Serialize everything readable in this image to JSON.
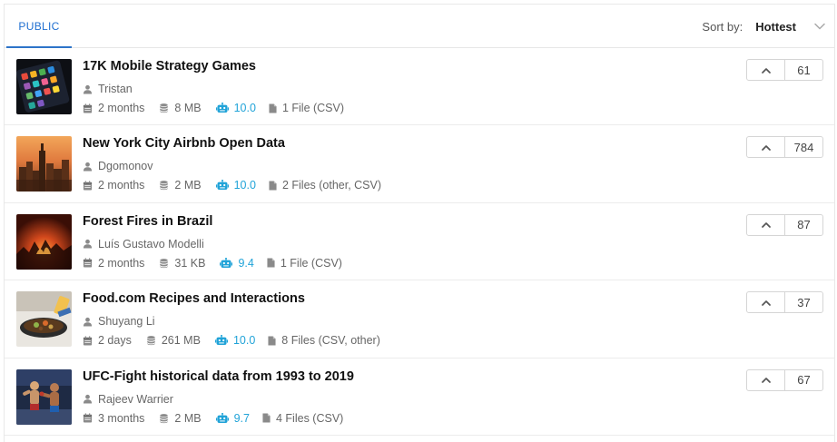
{
  "tabs": {
    "public_label": "PUBLIC"
  },
  "sort": {
    "label": "Sort by:",
    "value": "Hottest"
  },
  "colors": {
    "accent": "#2d74c9",
    "usability": "#20a3d8",
    "muted": "#8a8a8a"
  },
  "datasets": [
    {
      "title": "17K Mobile Strategy Games",
      "owner": "Tristan",
      "updated": "2 months",
      "size": "8 MB",
      "usability": "10.0",
      "files": "1 File (CSV)",
      "votes": "61"
    },
    {
      "title": "New York City Airbnb Open Data",
      "owner": "Dgomonov",
      "updated": "2 months",
      "size": "2 MB",
      "usability": "10.0",
      "files": "2 Files (other, CSV)",
      "votes": "784"
    },
    {
      "title": "Forest Fires in Brazil",
      "owner": "Luís Gustavo Modelli",
      "updated": "2 months",
      "size": "31 KB",
      "usability": "9.4",
      "files": "1 File (CSV)",
      "votes": "87"
    },
    {
      "title": "Food.com Recipes and Interactions",
      "owner": "Shuyang Li",
      "updated": "2 days",
      "size": "261 MB",
      "usability": "10.0",
      "files": "8 Files (CSV, other)",
      "votes": "37"
    },
    {
      "title": "UFC-Fight historical data from 1993 to 2019",
      "owner": "Rajeev Warrier",
      "updated": "3 months",
      "size": "2 MB",
      "usability": "9.7",
      "files": "4 Files (CSV)",
      "votes": "67"
    }
  ]
}
